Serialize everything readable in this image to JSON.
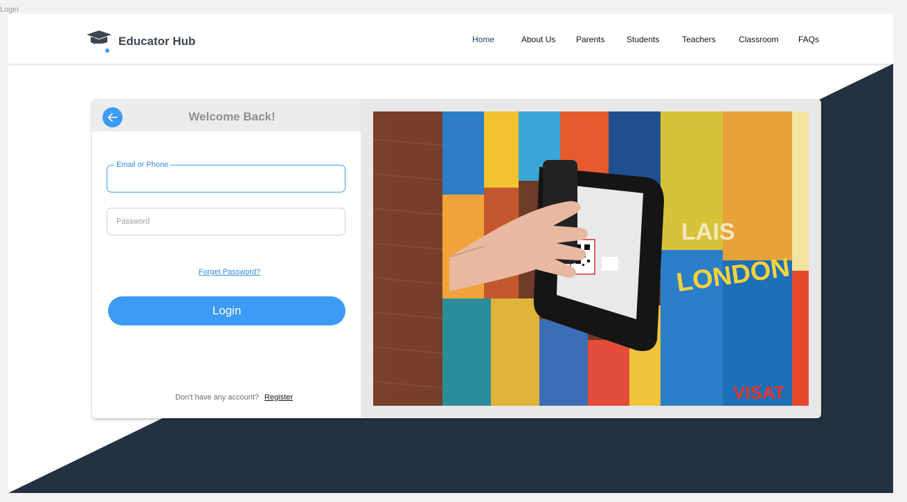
{
  "frame_label": "Login",
  "brand": {
    "name": "Educator Hub",
    "logo_icon": "graduation-cap-icon",
    "logo_color": "#3c4650",
    "accent": "#3b9bf5"
  },
  "nav": {
    "items": [
      {
        "label": "Home",
        "active": true
      },
      {
        "label": "About Us"
      },
      {
        "label": "Parents"
      },
      {
        "label": "Students"
      },
      {
        "label": "Teachers"
      },
      {
        "label": "Classroom"
      },
      {
        "label": "FAQs"
      }
    ]
  },
  "login": {
    "back_icon": "arrow-left-icon",
    "title": "Welcome Back!",
    "email_label": "Email or Phone",
    "email_value": "",
    "password_placeholder": "Password",
    "password_value": "",
    "forget_label": "Forget Password?",
    "login_label": "Login",
    "no_account_text": "Don't have any account?",
    "register_label": "Register"
  },
  "hero_image": {
    "description_icon": "photo-hand-scanning-qr-tablet"
  },
  "colors": {
    "dark_band": "#233240",
    "primary": "#3b9bf5",
    "header_bg": "#ececec"
  }
}
